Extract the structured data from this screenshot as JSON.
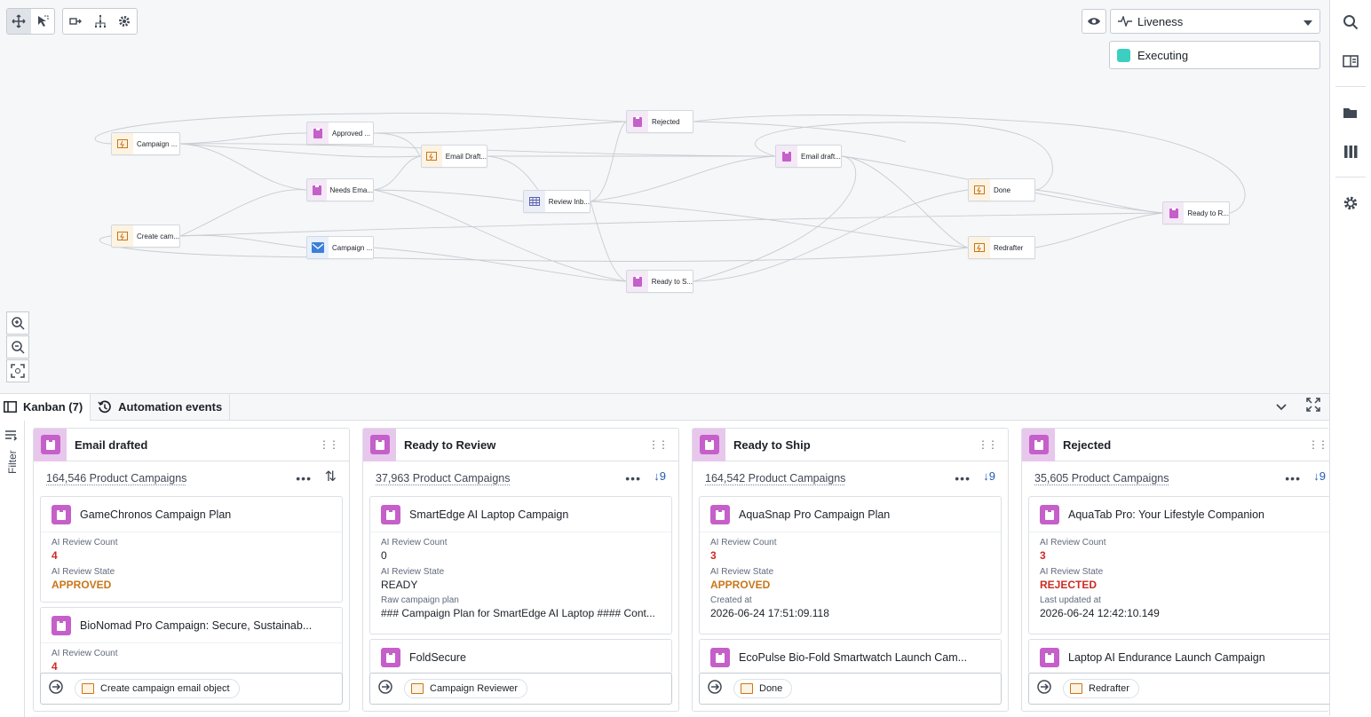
{
  "toolbar": {
    "icons": [
      "move-icon",
      "select-icon",
      "layout-icon",
      "hierarchy-icon",
      "gear-icon"
    ]
  },
  "liveness": {
    "label": "Liveness",
    "legend_label": "Executing",
    "legend_color": "#3ccfc1"
  },
  "graph": {
    "nodes": {
      "campaign": "Campaign ...",
      "approved": "Approved ...",
      "rejected": "Rejected",
      "email_drafted_action": "Email Draft...",
      "email_drafted": "Email draft...",
      "needs_email": "Needs Ema...",
      "review_inbox": "Review Inb...",
      "done": "Done",
      "ready_to_review": "Ready to R...",
      "create_campaign": "Create cam...",
      "campaign_mail": "Campaign ...",
      "redrafter": "Redrafter",
      "ready_to_ship": "Ready to S..."
    }
  },
  "bottom": {
    "tabs": [
      {
        "label": "Kanban (7)"
      },
      {
        "label": "Automation events"
      }
    ],
    "filter_label": "Filter"
  },
  "columns": [
    {
      "title": "Email drafted",
      "count": "164,546 Product Campaigns",
      "sort": "⇅",
      "cards": [
        {
          "title": "GameChronos Campaign Plan",
          "fields": [
            {
              "label": "AI Review Count",
              "value": "4"
            },
            {
              "label": "AI Review State",
              "value": "APPROVED"
            }
          ]
        },
        {
          "title": "BioNomad Pro Campaign: Secure, Sustainab...",
          "fields": [
            {
              "label": "AI Review Count",
              "value": "4"
            }
          ]
        }
      ],
      "action": "Create campaign email object"
    },
    {
      "title": "Ready to Review",
      "count": "37,963 Product Campaigns",
      "sort": "↓9",
      "cards": [
        {
          "title": "SmartEdge AI Laptop Campaign",
          "fields": [
            {
              "label": "AI Review Count",
              "value": "0"
            },
            {
              "label": "AI Review State",
              "value": "READY"
            },
            {
              "label": "Raw campaign plan",
              "value": "### Campaign Plan for SmartEdge AI Laptop #### Cont..."
            }
          ]
        },
        {
          "title": "FoldSecure",
          "fields": []
        }
      ],
      "action": "Campaign Reviewer"
    },
    {
      "title": "Ready to Ship",
      "count": "164,542 Product Campaigns",
      "sort": "↓9",
      "cards": [
        {
          "title": "AquaSnap Pro Campaign Plan",
          "fields": [
            {
              "label": "AI Review Count",
              "value": "3"
            },
            {
              "label": "AI Review State",
              "value": "APPROVED"
            },
            {
              "label": "Created at",
              "value": "2026-06-24 17:51:09.118"
            }
          ]
        },
        {
          "title": "EcoPulse Bio-Fold Smartwatch Launch Cam...",
          "fields": []
        }
      ],
      "action": "Done"
    },
    {
      "title": "Rejected",
      "count": "35,605 Product Campaigns",
      "sort": "↓9",
      "cards": [
        {
          "title": "AquaTab Pro: Your Lifestyle Companion",
          "fields": [
            {
              "label": "AI Review Count",
              "value": "3"
            },
            {
              "label": "AI Review State",
              "value": "REJECTED"
            },
            {
              "label": "Last updated at",
              "value": "2026-06-24 12:42:10.149"
            }
          ]
        },
        {
          "title": "Laptop AI Endurance Launch Campaign",
          "fields": []
        }
      ],
      "action": "Redrafter"
    }
  ]
}
